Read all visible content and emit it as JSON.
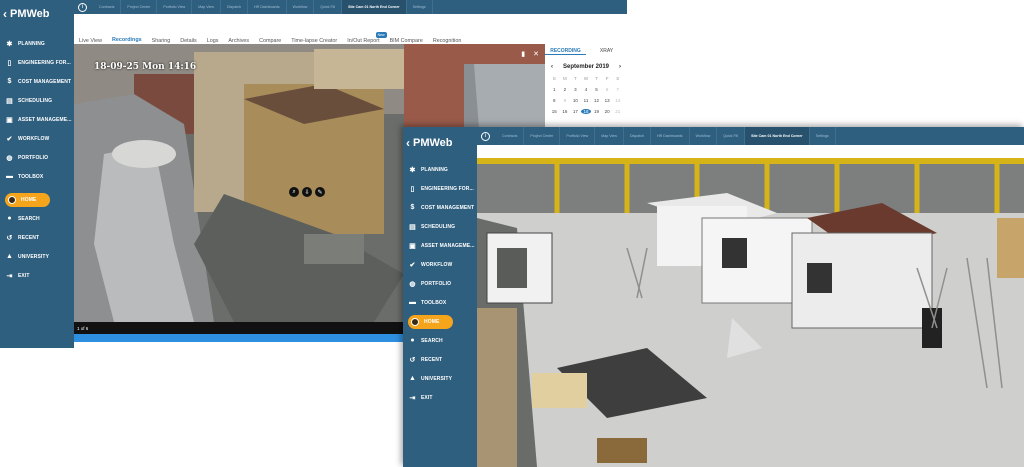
{
  "brand": {
    "logo_text": "PMWeb",
    "chevron": "‹"
  },
  "sidebar_items": [
    {
      "icon": "bulb-icon",
      "glyph": "✱",
      "label": "PLANNING"
    },
    {
      "icon": "document-icon",
      "glyph": "▯",
      "label": "ENGINEERING FOR..."
    },
    {
      "icon": "dollar-icon",
      "glyph": "$",
      "label": "COST MANAGEMENT"
    },
    {
      "icon": "calendar-icon",
      "glyph": "▤",
      "label": "SCHEDULING"
    },
    {
      "icon": "asset-icon",
      "glyph": "▣",
      "label": "ASSET MANAGEME..."
    },
    {
      "icon": "check-icon",
      "glyph": "✔",
      "label": "WORKFLOW"
    },
    {
      "icon": "globe-icon",
      "glyph": "◍",
      "label": "PORTFOLIO"
    },
    {
      "icon": "toolbox-icon",
      "glyph": "▬",
      "label": "TOOLBOX"
    },
    {
      "icon": "home-icon",
      "glyph": "",
      "label": "HOME",
      "active": true
    },
    {
      "icon": "search-icon",
      "glyph": "●",
      "label": "SEARCH"
    },
    {
      "icon": "recent-icon",
      "glyph": "↺",
      "label": "RECENT"
    },
    {
      "icon": "graduation-cap-icon",
      "glyph": "▲",
      "label": "UNIVERSITY"
    },
    {
      "icon": "exit-icon",
      "glyph": "⇥",
      "label": "EXIT"
    }
  ],
  "top_tabs": [
    {
      "label": "Contracts"
    },
    {
      "label": "Project Center"
    },
    {
      "label": "Portfolio View"
    },
    {
      "label": "Map View"
    },
    {
      "label": "Dispatch"
    },
    {
      "label": "HR Dashboards"
    },
    {
      "label": "Workflow"
    },
    {
      "label": "Quick Fill"
    },
    {
      "label": "Site Cam 01 North End Corner",
      "active": true
    },
    {
      "label": "Settings"
    }
  ],
  "sub_tabs": [
    {
      "label": "Live View"
    },
    {
      "label": "Recordings",
      "active": true
    },
    {
      "label": "Sharing"
    },
    {
      "label": "Details"
    },
    {
      "label": "Logs"
    },
    {
      "label": "Archives"
    },
    {
      "label": "Compare"
    },
    {
      "label": "Time-lapse Creator"
    },
    {
      "label": "In/Out Report",
      "badge": "New"
    },
    {
      "label": "BIM Compare"
    },
    {
      "label": "Recognition"
    }
  ],
  "video": {
    "timestamp_overlay": "18-09-25   Mon 14:16",
    "page_indicator": "1 of 6"
  },
  "calendar": {
    "tab_recording": "RECORDING",
    "tab_xray": "XRAY",
    "month_label": "September 2019",
    "day_headers": [
      "S",
      "M",
      "T",
      "W",
      "T",
      "F",
      "S"
    ],
    "days": [
      {
        "d": "1",
        "m": false
      },
      {
        "d": "2",
        "m": false
      },
      {
        "d": "3",
        "m": false
      },
      {
        "d": "4",
        "m": false
      },
      {
        "d": "5",
        "m": false
      },
      {
        "d": "6",
        "m": true
      },
      {
        "d": "7",
        "m": true
      },
      {
        "d": "8",
        "m": false
      },
      {
        "d": "9",
        "m": true
      },
      {
        "d": "10",
        "m": false
      },
      {
        "d": "11",
        "m": false
      },
      {
        "d": "12",
        "m": false
      },
      {
        "d": "13",
        "m": false
      },
      {
        "d": "14",
        "m": true
      },
      {
        "d": "15",
        "m": false
      },
      {
        "d": "16",
        "m": false
      },
      {
        "d": "17",
        "m": false
      },
      {
        "d": "18",
        "s": true
      },
      {
        "d": "19",
        "m": false
      },
      {
        "d": "20",
        "m": false
      },
      {
        "d": "21",
        "m": true
      }
    ]
  },
  "colors": {
    "sidebar": "#2f5f7f",
    "accent": "#2a7ab8",
    "home_pill": "#f4a51c",
    "progress": "#2e8fe0"
  }
}
